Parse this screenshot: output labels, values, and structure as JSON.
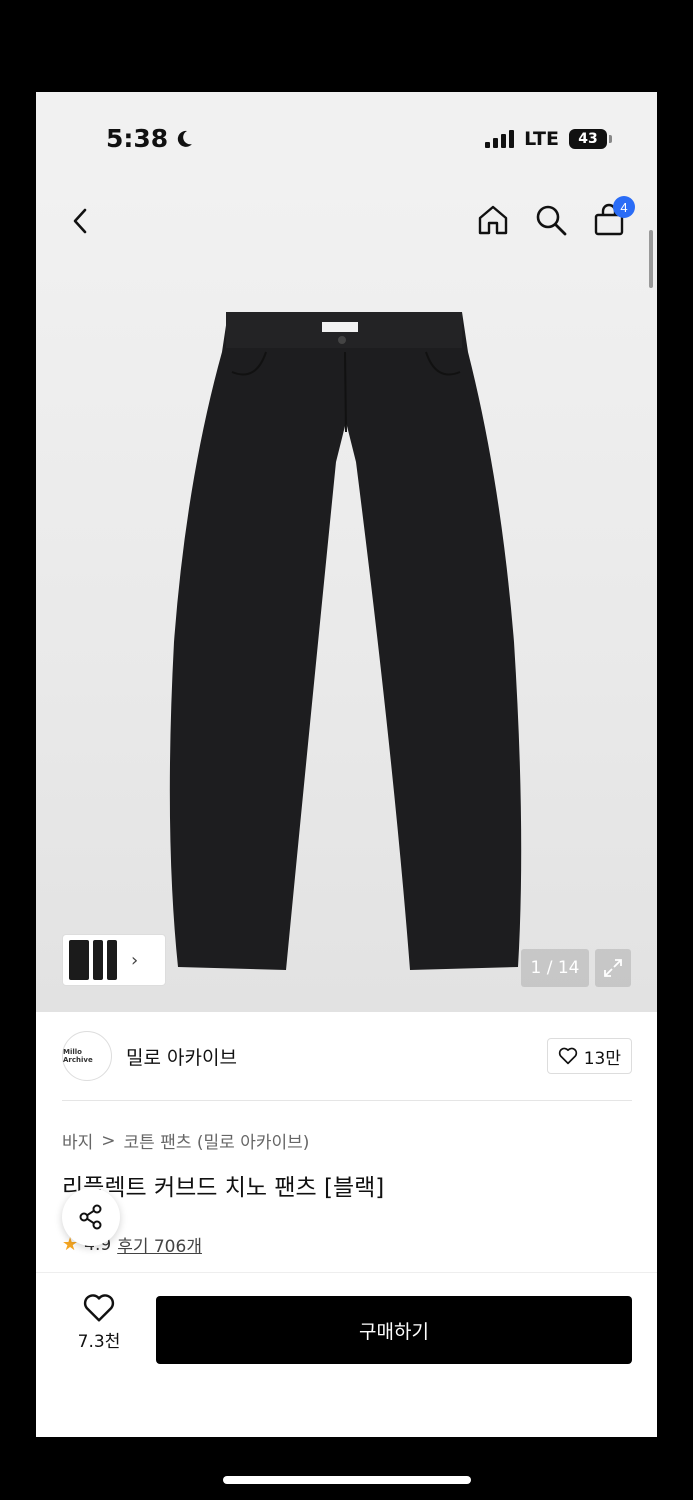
{
  "status_bar": {
    "time": "5:38",
    "network": "LTE",
    "battery": "43"
  },
  "nav": {
    "cart_count": "4"
  },
  "gallery": {
    "counter": "1 / 14"
  },
  "seller": {
    "avatar_text": "Millo Archive",
    "name": "밀로 아카이브",
    "favorites": "13만"
  },
  "breadcrumb": {
    "level1": "바지",
    "separator": ">",
    "level2": "코튼 팬츠 (밀로 아카이브)"
  },
  "product": {
    "title": "리플렉트 커브드 치노 팬츠 [블랙]",
    "rating": "4.9",
    "reviews": "후기 706개"
  },
  "bottom_bar": {
    "like_count": "7.3천",
    "buy_label": "구매하기"
  },
  "colors": {
    "accent": "#2a6cf6",
    "buy_button": "#000000",
    "star": "#f5a623"
  }
}
